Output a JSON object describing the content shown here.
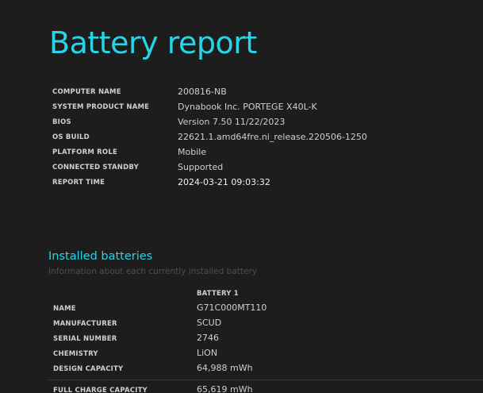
{
  "report": {
    "title": "Battery report"
  },
  "system_info": [
    {
      "label": "COMPUTER NAME",
      "value": "200816-NB"
    },
    {
      "label": "SYSTEM PRODUCT NAME",
      "value": "Dynabook Inc. PORTEGE X40L-K"
    },
    {
      "label": "BIOS",
      "value": "Version 7.50 11/22/2023"
    },
    {
      "label": "OS BUILD",
      "value": "22621.1.amd64fre.ni_release.220506-1250"
    },
    {
      "label": "PLATFORM ROLE",
      "value": "Mobile"
    },
    {
      "label": "CONNECTED STANDBY",
      "value": "Supported"
    },
    {
      "label": "REPORT TIME",
      "value": "2024-03-21  09:03:32"
    }
  ],
  "installed_batteries": {
    "title": "Installed batteries",
    "subtitle": "Information about each currently installed battery",
    "column_header": "BATTERY 1",
    "rows": [
      {
        "label": "NAME",
        "value": "G71C000MT110"
      },
      {
        "label": "MANUFACTURER",
        "value": "SCUD"
      },
      {
        "label": "SERIAL NUMBER",
        "value": "2746"
      },
      {
        "label": "CHEMISTRY",
        "value": "LiON"
      },
      {
        "label": "DESIGN CAPACITY",
        "value": "64,988 mWh"
      },
      {
        "label": "FULL CHARGE CAPACITY",
        "value": "65,619 mWh"
      }
    ]
  },
  "colors": {
    "background": "#1d1d1d",
    "accent": "#2ad3e6",
    "text": "#cfcfcf",
    "muted": "#4e4e4e"
  }
}
